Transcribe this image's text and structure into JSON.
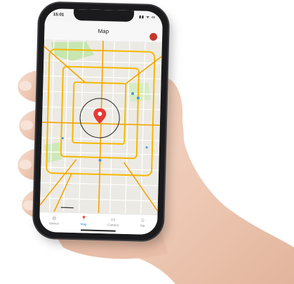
{
  "status_bar": {
    "time": "15:01",
    "icons": "▮▮ ᯤ ▭"
  },
  "app": {
    "title": "Map"
  },
  "map": {
    "center_label": "",
    "accent_color": "#e53935"
  },
  "tabbar": {
    "items": [
      {
        "label": "Device",
        "icon": "device-icon"
      },
      {
        "label": "Map",
        "icon": "map-pin-icon"
      },
      {
        "label": "Camera",
        "icon": "camera-icon"
      },
      {
        "label": "Me",
        "icon": "person-icon"
      }
    ],
    "active_color": "#1e88e5"
  }
}
